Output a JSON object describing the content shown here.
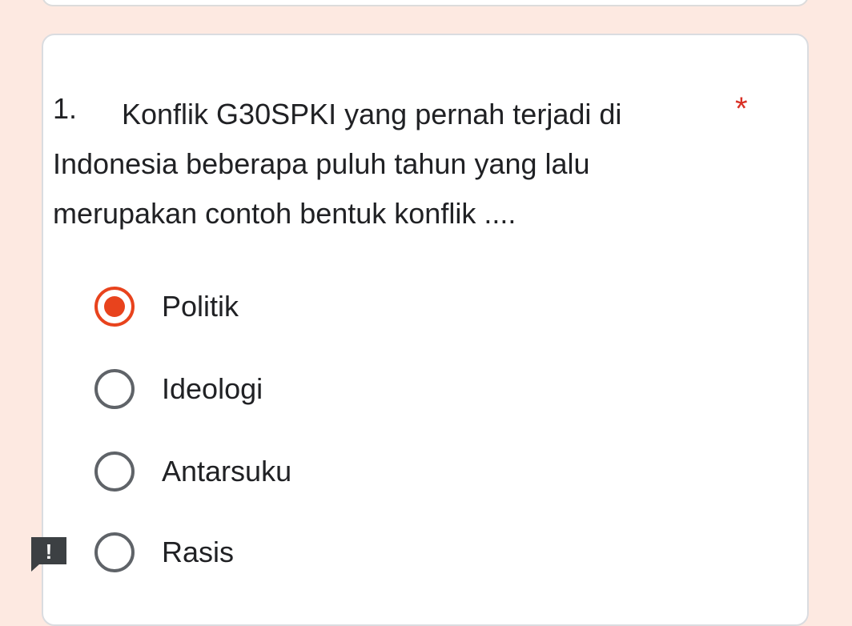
{
  "question": {
    "number": "1.",
    "text": "Konflik G30SPKI yang pernah terjadi di Indonesia beberapa puluh tahun yang lalu merupakan contoh bentuk konflik ....",
    "required_marker": "*"
  },
  "options": [
    {
      "label": "Politik",
      "selected": true
    },
    {
      "label": "Ideologi",
      "selected": false
    },
    {
      "label": "Antarsuku",
      "selected": false
    },
    {
      "label": "Rasis",
      "selected": false
    }
  ],
  "feedback_icon": {
    "icon": "report-issue-icon",
    "symbol": "!"
  },
  "colors": {
    "background": "#fde9e1",
    "accent": "#e8431d",
    "required": "#d93025",
    "badge": "#3c4043"
  }
}
